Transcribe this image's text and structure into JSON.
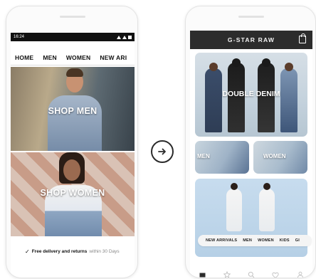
{
  "left_phone": {
    "status_time": "16:24",
    "nav": [
      "HOME",
      "MEN",
      "WOMEN",
      "NEW ARI"
    ],
    "promo_men": "SHOP MEN",
    "promo_women": "SHOP WOMEN",
    "delivery_bold": "Free delivery and returns",
    "delivery_muted": "within 30 Days"
  },
  "right_phone": {
    "brand": "G-STAR RAW",
    "hero": "DOUBLE DENIM",
    "men": "MEN",
    "women": "WOMEN",
    "pill_nav": [
      "NEW ARRIVALS",
      "MEN",
      "WOMEN",
      "KIDS",
      "GI"
    ]
  },
  "icons": {
    "arrow": "arrow-right-circle-icon",
    "bag": "shopping-bag-icon",
    "tabs": [
      "home-icon",
      "star-icon",
      "search-icon",
      "heart-icon",
      "user-icon"
    ]
  },
  "colors": {
    "header_bg": "#2c2c2c",
    "status_bg": "#111111"
  }
}
